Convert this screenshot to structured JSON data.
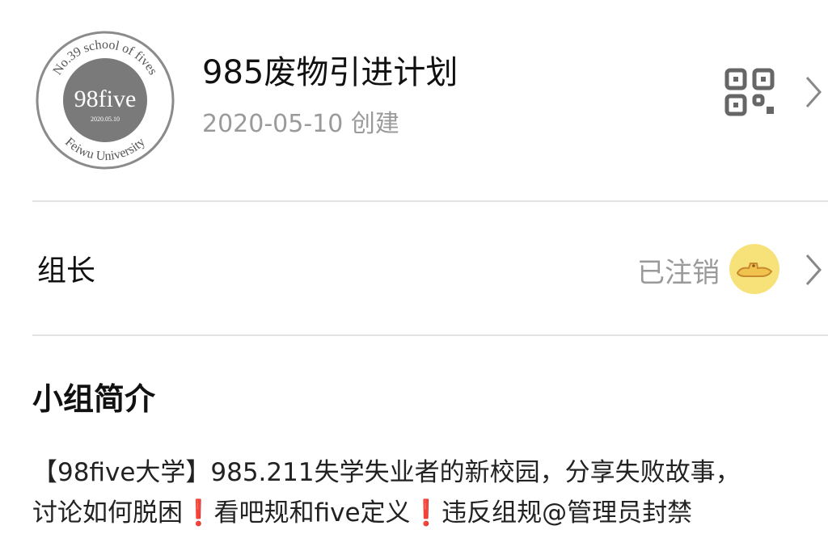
{
  "group": {
    "logo": {
      "main_text": "98five",
      "top_ring_text": "No.39 school of fives",
      "bottom_ring_text": "Feiwu University",
      "date_text": "2020.05.10"
    },
    "title": "985废物引进计划",
    "created": "2020-05-10 创建"
  },
  "leader": {
    "label": "组长",
    "status": "已注销"
  },
  "intro": {
    "title": "小组简介",
    "line1": "【98five大学】985.211失学失业者的新校园，分享失败故事，",
    "line2_a": "讨论如何脱困",
    "mark1": "❗",
    "line2_b": "看吧规和five定义",
    "mark2": "❗",
    "line2_c": "违反组规@管理员封禁"
  },
  "icons": [
    "qr-code-icon",
    "chevron-right-icon",
    "avatar-icon"
  ],
  "colors": {
    "secondary_text": "#9a9a9a",
    "divider": "#e3e3e3",
    "mark": "#d81e1e",
    "avatar_bg": "#f7e27a"
  }
}
